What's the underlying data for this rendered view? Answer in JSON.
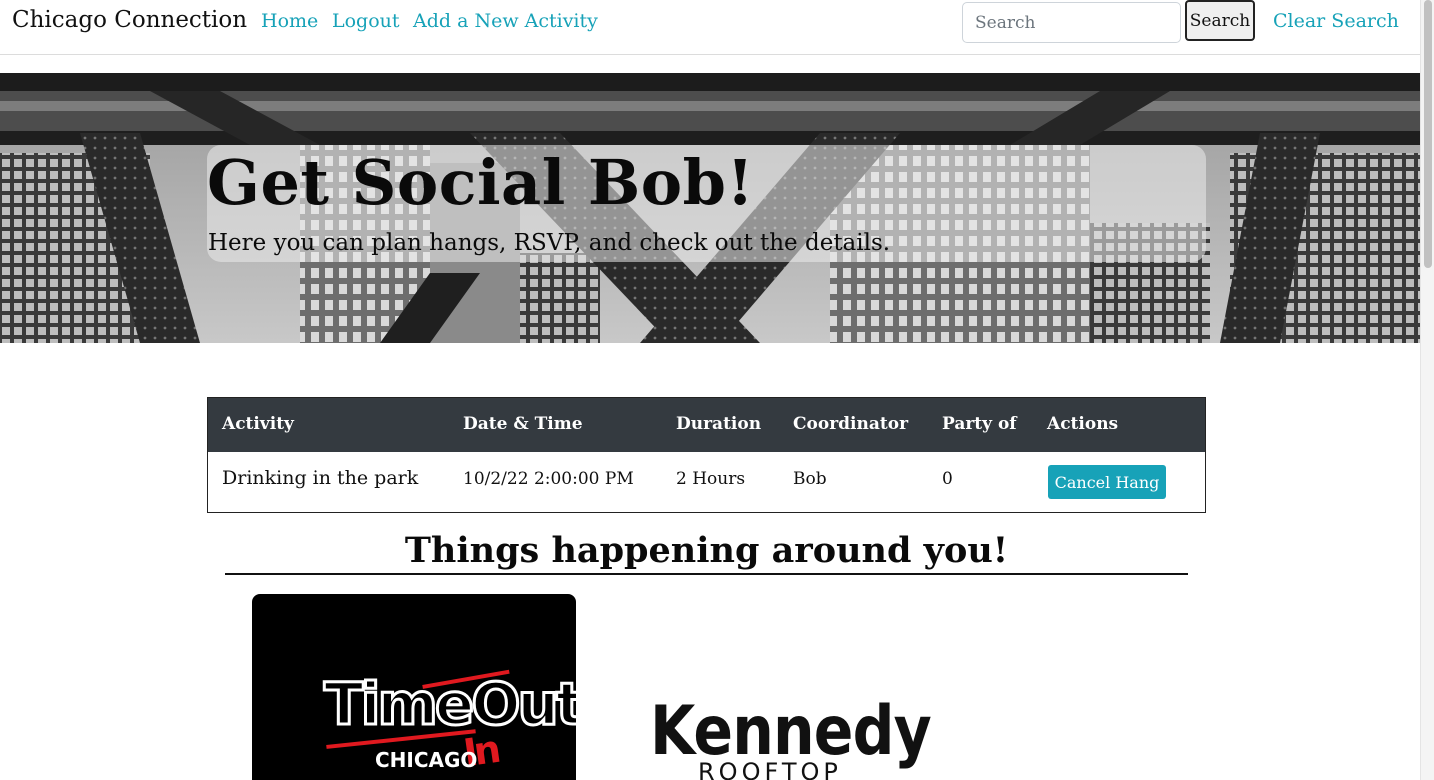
{
  "nav": {
    "brand": "Chicago Connection",
    "home": "Home",
    "logout": "Logout",
    "add": "Add a New Activity",
    "search_placeholder": "Search",
    "search_button": "Search",
    "clear": "Clear Search"
  },
  "hero": {
    "title": "Get Social Bob!",
    "subtitle": "Here you can plan hangs, RSVP, and check out the details."
  },
  "table": {
    "headers": [
      "Activity",
      "Date & Time",
      "Duration",
      "Coordinator",
      "Party of",
      "Actions"
    ],
    "rows": [
      {
        "activity": "Drinking in the park",
        "datetime": "10/2/22 2:00:00 PM",
        "duration": "2 Hours",
        "coordinator": "Bob",
        "party": "0",
        "action": "Cancel Hang"
      }
    ]
  },
  "section": {
    "title": "Things happening around you!"
  },
  "cards": [
    {
      "logo_text": "TimeOut",
      "logo_sub": "CHICAGO",
      "logo_mark": "In"
    },
    {
      "logo_text": "Kennedy",
      "logo_sub": "ROOFTOP"
    }
  ],
  "colors": {
    "accent": "#17a2b8",
    "table_header": "#343a40",
    "logo_red": "#e0191f"
  }
}
